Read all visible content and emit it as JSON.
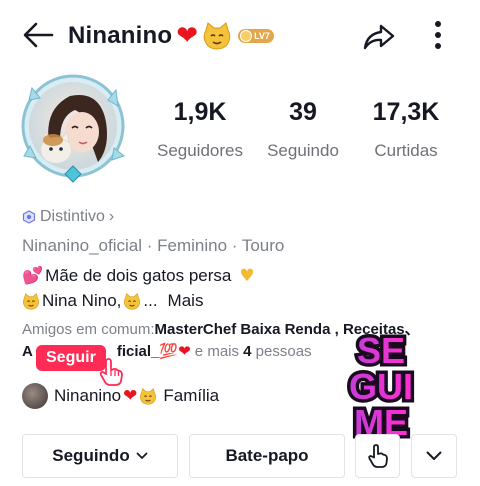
{
  "header": {
    "username": "Ninanino",
    "level_badge": "LV7"
  },
  "profile": {
    "stats": [
      {
        "value": "1,9K",
        "label": "Seguidores"
      },
      {
        "value": "39",
        "label": "Seguindo"
      },
      {
        "value": "17,3K",
        "label": "Curtidas"
      }
    ],
    "badge_label": "Distintivo",
    "badge_chevron": "›",
    "meta": "Ninanino_oficial · Feminino · Touro",
    "bio_line1": "Mãe de dois gatos persa",
    "bio_line2_a": "Nina Nino,",
    "bio_line2_b": "...",
    "more_label": "Mais",
    "mutual_prefix": "Amigos em comum:",
    "mutual_names": "MasterChef Baixa Renda , Receitas、",
    "mutual2_start": "A",
    "mutual2_name": "ficial_",
    "mutual2_hundred": "💯",
    "mutual2_suffix": " e mais ",
    "mutual2_count": "4",
    "mutual2_end": " pessoas"
  },
  "overlay": {
    "follow_label": "Seguir",
    "sticker_lines": [
      "SE",
      "GUI",
      "ME"
    ]
  },
  "family": {
    "name": "Ninanino",
    "label": "Família"
  },
  "actions": {
    "following_label": "Seguindo",
    "chat_label": "Bate-papo"
  },
  "icons": {
    "back": "arrow-left-icon",
    "share": "share-icon",
    "more": "more-vertical-icon",
    "chevron": "chevron-down-icon",
    "hand": "hand-icon"
  },
  "colors": {
    "accent": "#fe2c55",
    "heart": "#e8141f",
    "muted": "#7d8089",
    "text": "#161823",
    "sticker": "#e51bd3"
  }
}
